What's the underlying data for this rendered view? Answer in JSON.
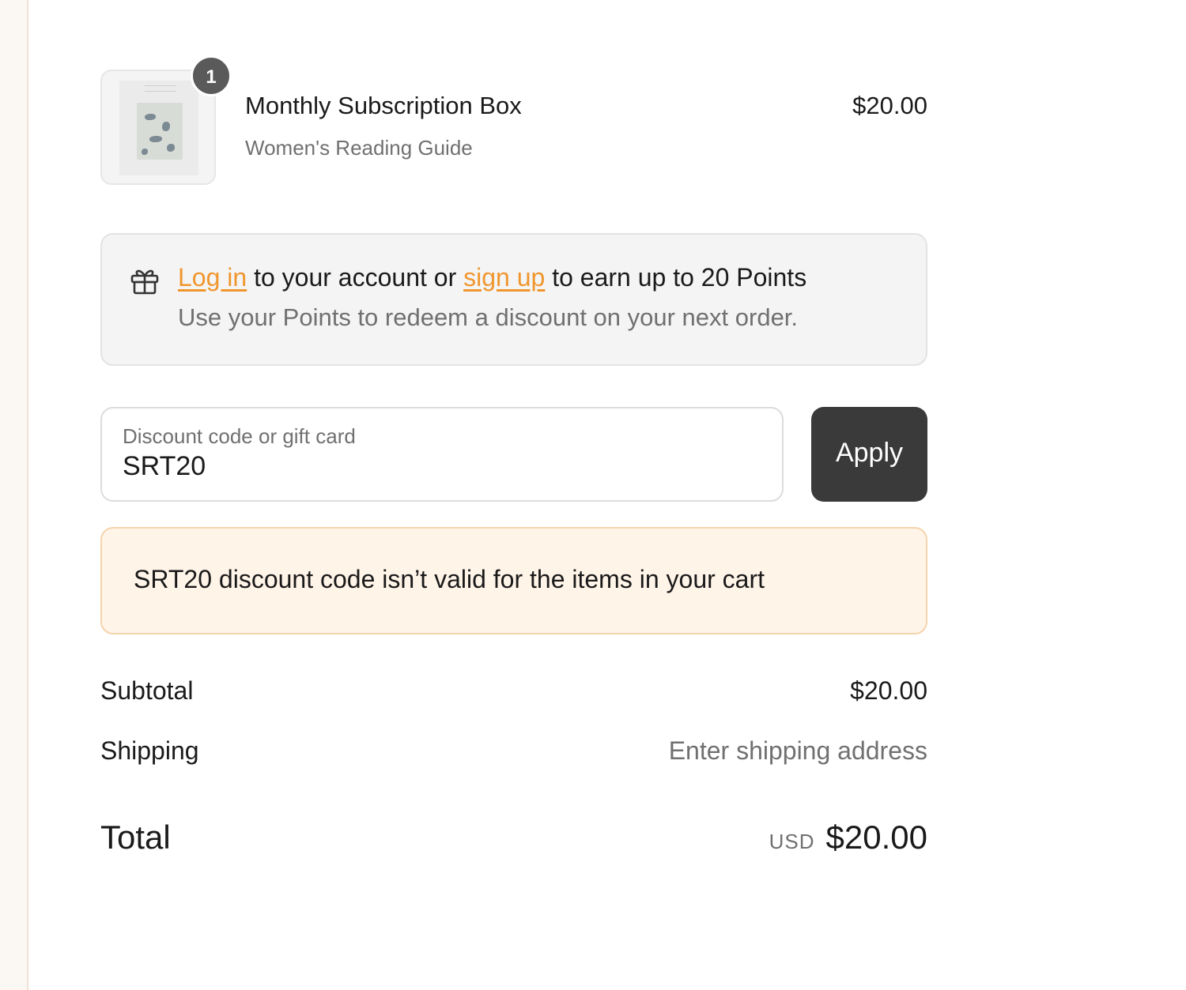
{
  "cart": {
    "item": {
      "quantity": "1",
      "title": "Monthly Subscription Box",
      "variant": "Women's Reading Guide",
      "price": "$20.00",
      "thumbnail_icon": "book-cover-image"
    }
  },
  "points": {
    "icon": "gift-icon",
    "login_link": "Log in",
    "text_middle": " to your account or ",
    "signup_link": "sign up",
    "text_end": " to earn up to 20 Points",
    "subtext": "Use your Points to redeem a discount on your next order.",
    "link_color": "#f0962e"
  },
  "discount": {
    "label": "Discount code or gift card",
    "value": "SRT20",
    "apply_label": "Apply"
  },
  "notice": {
    "message": "SRT20 discount code isn’t valid for the items in your cart",
    "background": "#fff4e8"
  },
  "totals": {
    "subtotal_label": "Subtotal",
    "subtotal_value": "$20.00",
    "shipping_label": "Shipping",
    "shipping_value": "Enter shipping address",
    "total_label": "Total",
    "currency": "USD",
    "total_value": "$20.00"
  }
}
